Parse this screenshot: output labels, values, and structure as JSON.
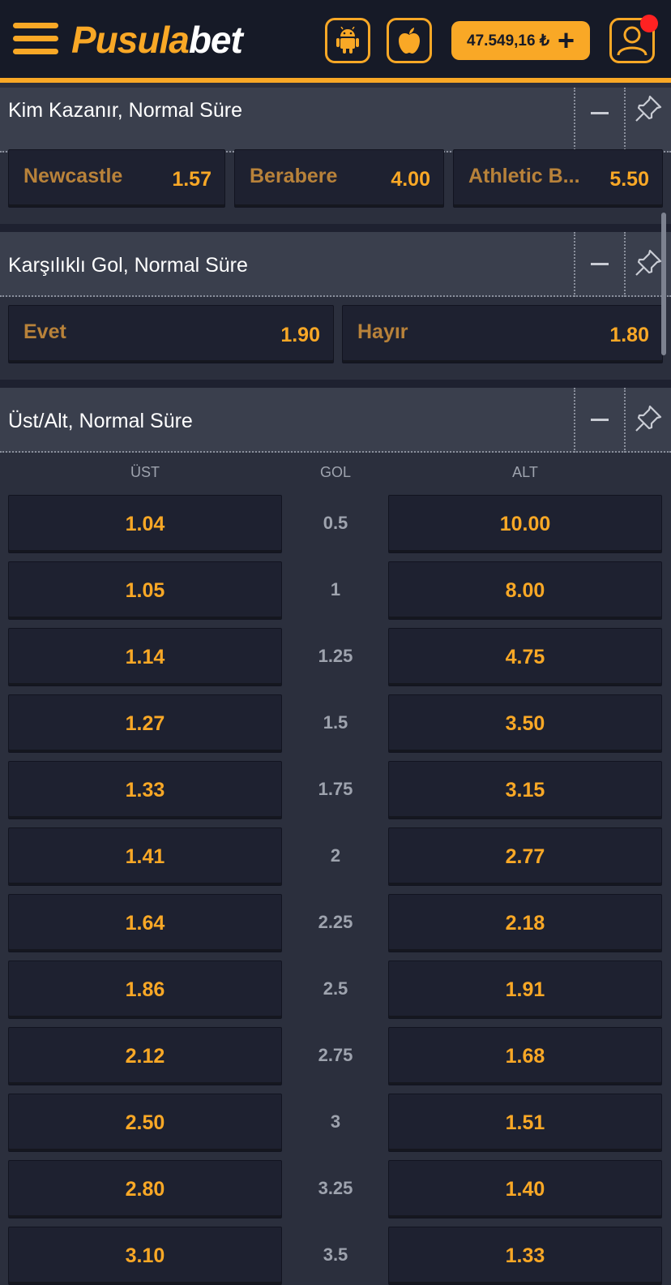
{
  "header": {
    "logo_part1": "Pusula",
    "logo_part2": "bet",
    "balance": "47.549,16 ₺",
    "balance_plus": "+",
    "accent_color": "#f9a826"
  },
  "markets": [
    {
      "title": "Kim Kazanır, Normal Süre",
      "outcomes": [
        {
          "label": "Newcastle",
          "odd": "1.57"
        },
        {
          "label": "Berabere",
          "odd": "4.00"
        },
        {
          "label": "Athletic B...",
          "odd": "5.50"
        }
      ]
    },
    {
      "title": "Karşılıklı Gol, Normal Süre",
      "outcomes": [
        {
          "label": "Evet",
          "odd": "1.90"
        },
        {
          "label": "Hayır",
          "odd": "1.80"
        }
      ]
    },
    {
      "title": "Üst/Alt, Normal Süre",
      "columns": {
        "over": "ÜST",
        "line": "GOL",
        "under": "ALT"
      },
      "rows": [
        {
          "over": "1.04",
          "line": "0.5",
          "under": "10.00"
        },
        {
          "over": "1.05",
          "line": "1",
          "under": "8.00"
        },
        {
          "over": "1.14",
          "line": "1.25",
          "under": "4.75"
        },
        {
          "over": "1.27",
          "line": "1.5",
          "under": "3.50"
        },
        {
          "over": "1.33",
          "line": "1.75",
          "under": "3.15"
        },
        {
          "over": "1.41",
          "line": "2",
          "under": "2.77"
        },
        {
          "over": "1.64",
          "line": "2.25",
          "under": "2.18"
        },
        {
          "over": "1.86",
          "line": "2.5",
          "under": "1.91"
        },
        {
          "over": "2.12",
          "line": "2.75",
          "under": "1.68"
        },
        {
          "over": "2.50",
          "line": "3",
          "under": "1.51"
        },
        {
          "over": "2.80",
          "line": "3.25",
          "under": "1.40"
        },
        {
          "over": "3.10",
          "line": "3.5",
          "under": "1.33"
        }
      ]
    }
  ],
  "icons": {
    "menu": "hamburger-icon",
    "android": "android-icon",
    "apple": "apple-icon",
    "profile": "user-icon",
    "collapse": "minus-icon",
    "pin": "pin-icon"
  }
}
